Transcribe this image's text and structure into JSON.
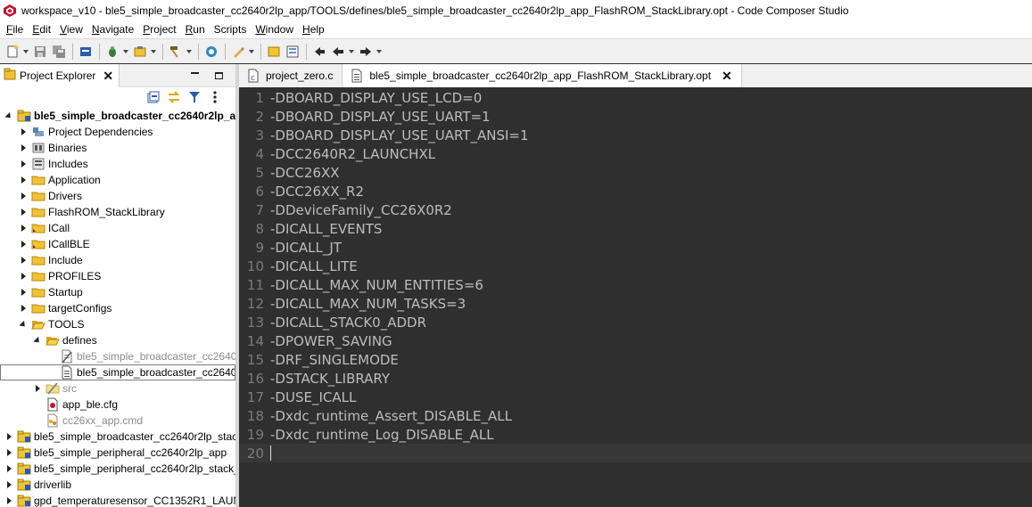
{
  "window": {
    "title": "workspace_v10 - ble5_simple_broadcaster_cc2640r2lp_app/TOOLS/defines/ble5_simple_broadcaster_cc2640r2lp_app_FlashROM_StackLibrary.opt - Code Composer Studio"
  },
  "menu": [
    {
      "u": "F",
      "rest": "ile"
    },
    {
      "u": "E",
      "rest": "dit"
    },
    {
      "u": "V",
      "rest": "iew"
    },
    {
      "u": "N",
      "rest": "avigate"
    },
    {
      "u": "P",
      "rest": "roject"
    },
    {
      "u": "R",
      "rest": "un"
    },
    {
      "u": "",
      "rest": "Scripts"
    },
    {
      "u": "W",
      "rest": "indow"
    },
    {
      "u": "H",
      "rest": "elp"
    }
  ],
  "project_explorer": {
    "title": "Project Explorer",
    "tree": [
      {
        "label": "ble5_simple_broadcaster_cc2640r2lp_ap",
        "twisty": "open",
        "icon": "project-icon",
        "bold": true,
        "dim": false
      },
      {
        "label": "Project Dependencies",
        "twisty": "closed",
        "icon": "dependencies-icon",
        "bold": false,
        "dim": false
      },
      {
        "label": "Binaries",
        "twisty": "closed",
        "icon": "binaries-icon",
        "bold": false,
        "dim": false
      },
      {
        "label": "Includes",
        "twisty": "closed",
        "icon": "includes-icon",
        "bold": false,
        "dim": false
      },
      {
        "label": "Application",
        "twisty": "closed",
        "icon": "folder-icon",
        "bold": false,
        "dim": false
      },
      {
        "label": "Drivers",
        "twisty": "closed",
        "icon": "folder-icon",
        "bold": false,
        "dim": false
      },
      {
        "label": "FlashROM_StackLibrary",
        "twisty": "closed",
        "icon": "folder-icon",
        "bold": false,
        "dim": false
      },
      {
        "label": "ICall",
        "twisty": "closed",
        "icon": "linked-folder-icon",
        "bold": false,
        "dim": false
      },
      {
        "label": "ICallBLE",
        "twisty": "closed",
        "icon": "linked-folder-icon",
        "bold": false,
        "dim": false
      },
      {
        "label": "Include",
        "twisty": "closed",
        "icon": "folder-icon",
        "bold": false,
        "dim": false
      },
      {
        "label": "PROFILES",
        "twisty": "closed",
        "icon": "folder-icon",
        "bold": false,
        "dim": false
      },
      {
        "label": "Startup",
        "twisty": "closed",
        "icon": "folder-icon",
        "bold": false,
        "dim": false
      },
      {
        "label": "targetConfigs",
        "twisty": "closed",
        "icon": "folder-icon",
        "bold": false,
        "dim": false
      },
      {
        "label": "TOOLS",
        "twisty": "open",
        "icon": "folder-open-icon",
        "bold": false,
        "dim": false
      },
      {
        "label": "defines",
        "twisty": "open",
        "icon": "folder-open-icon",
        "bold": false,
        "dim": false
      },
      {
        "label": "ble5_simple_broadcaster_cc2640",
        "twisty": "none",
        "icon": "excluded-file-icon",
        "bold": false,
        "dim": true
      },
      {
        "label": "ble5_simple_broadcaster_cc2640",
        "twisty": "none",
        "icon": "text-file-icon",
        "bold": false,
        "dim": false
      },
      {
        "label": "src",
        "twisty": "closed",
        "icon": "excluded-folder-icon",
        "bold": false,
        "dim": true
      },
      {
        "label": "app_ble.cfg",
        "twisty": "none",
        "icon": "cfg-file-icon",
        "bold": false,
        "dim": false
      },
      {
        "label": "cc26xx_app.cmd",
        "twisty": "none",
        "icon": "cmd-file-icon",
        "bold": false,
        "dim": true
      },
      {
        "label": "ble5_simple_broadcaster_cc2640r2lp_stac",
        "twisty": "closed",
        "icon": "project-icon",
        "bold": false,
        "dim": false
      },
      {
        "label": "ble5_simple_peripheral_cc2640r2lp_app",
        "twisty": "closed",
        "icon": "project-icon",
        "bold": false,
        "dim": false
      },
      {
        "label": "ble5_simple_peripheral_cc2640r2lp_stack_",
        "twisty": "closed",
        "icon": "project-icon",
        "bold": false,
        "dim": false
      },
      {
        "label": "driverlib",
        "twisty": "closed",
        "icon": "project-icon",
        "bold": false,
        "dim": false
      },
      {
        "label": "gpd_temperaturesensor_CC1352R1_LAUN",
        "twisty": "closed",
        "icon": "project-icon",
        "bold": false,
        "dim": false
      }
    ],
    "selected_index": 16
  },
  "editor": {
    "tabs": [
      {
        "label": "project_zero.c",
        "icon": "c-file-icon",
        "active": false
      },
      {
        "label": "ble5_simple_broadcaster_cc2640r2lp_app_FlashROM_StackLibrary.opt",
        "icon": "text-file-icon",
        "active": true
      }
    ],
    "lines": [
      "-DBOARD_DISPLAY_USE_LCD=0",
      "-DBOARD_DISPLAY_USE_UART=1",
      "-DBOARD_DISPLAY_USE_UART_ANSI=1",
      "-DCC2640R2_LAUNCHXL",
      "-DCC26XX",
      "-DCC26XX_R2",
      "-DDeviceFamily_CC26X0R2",
      "-DICALL_EVENTS",
      "-DICALL_JT",
      "-DICALL_LITE",
      "-DICALL_MAX_NUM_ENTITIES=6",
      "-DICALL_MAX_NUM_TASKS=3",
      "-DICALL_STACK0_ADDR",
      "-DPOWER_SAVING",
      "-DRF_SINGLEMODE",
      "-DSTACK_LIBRARY",
      "-DUSE_ICALL",
      "-Dxdc_runtime_Assert_DISABLE_ALL",
      "-Dxdc_runtime_Log_DISABLE_ALL",
      ""
    ],
    "current_line": 20
  }
}
